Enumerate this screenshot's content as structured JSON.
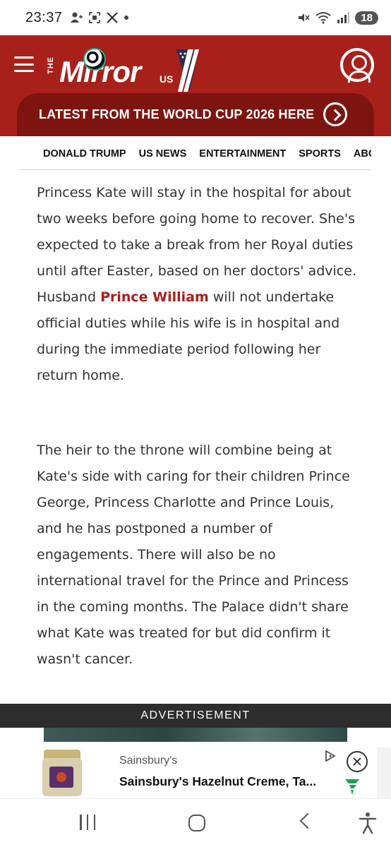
{
  "status_bar": {
    "time": "23:37",
    "left_icons": [
      "person-add-icon",
      "screenshot-icon",
      "x-app-icon",
      "dot-icon"
    ],
    "right_icons": [
      "mute-icon",
      "wifi-icon",
      "signal-icon"
    ],
    "battery": "18"
  },
  "header": {
    "logo_the": "THE",
    "logo_mirror": "Mirror",
    "logo_us": "US",
    "banner_text": "LATEST FROM THE WORLD CUP 2026 HERE",
    "colors": {
      "header_red": "#a8201a",
      "banner_red": "#7e1410"
    }
  },
  "nav": {
    "items": [
      "DONALD TRUMP",
      "US NEWS",
      "ENTERTAINMENT",
      "SPORTS",
      "ABOUT"
    ]
  },
  "article": {
    "para1_before_link": "Princess Kate will stay in the hospital for about two weeks before going home to recover. She's expected to take a break from her Royal duties until after Easter, based on her doctors' advice. Husband ",
    "para1_link": "Prince William",
    "para1_after_link": " will not undertake official duties while his wife is in hospital and during the immediate period following her return home.",
    "para2": "The heir to the throne will combine being at Kate's side with caring for their children Prince George, Princess Charlotte and Prince Louis, and he has postponed a number of engagements. There will also be no international travel for the Prince and Princess in the coming months. The Palace didn't share what Kate was treated for but did confirm it wasn't cancer."
  },
  "advertisement": {
    "label": "ADVERTISEMENT",
    "brand": "Sainsbury's",
    "title": "Sainsbury's Hazelnut Creme, Ta..."
  }
}
